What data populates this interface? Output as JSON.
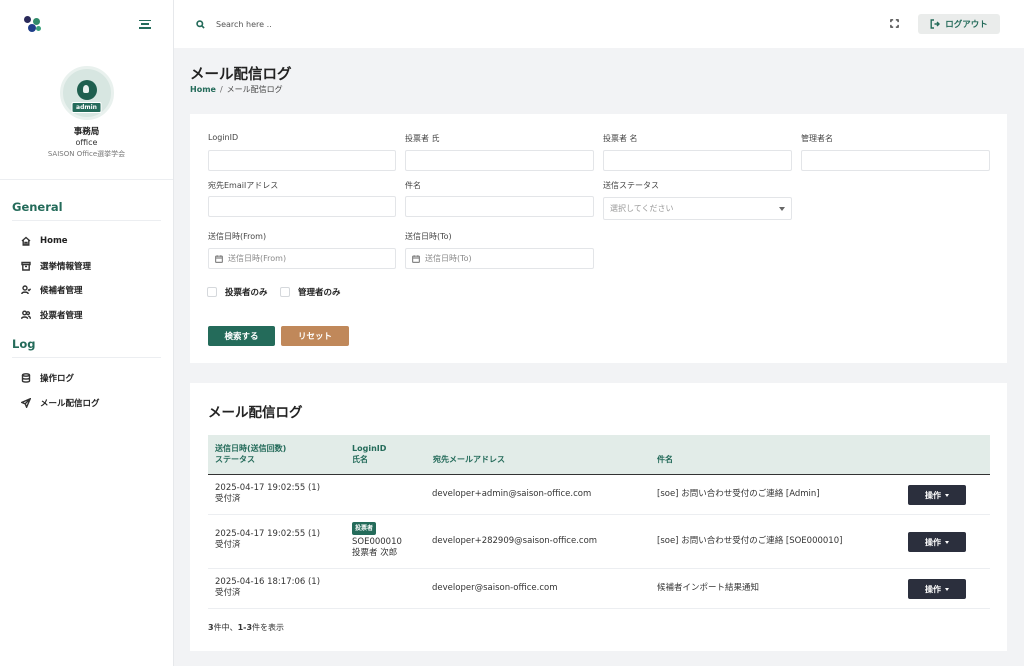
{
  "header": {
    "search_placeholder": "Search here ..",
    "logout_label": "ログアウト"
  },
  "profile": {
    "badge": "admin",
    "name": "事務局",
    "role": "office",
    "org": "SAISON Office選挙学会"
  },
  "sidebar": {
    "general_title": "General",
    "general_items": [
      "Home",
      "選挙情報管理",
      "候補者管理",
      "投票者管理"
    ],
    "log_title": "Log",
    "log_items": [
      "操作ログ",
      "メール配信ログ"
    ]
  },
  "page": {
    "title": "メール配信ログ",
    "breadcrumb_home": "Home",
    "breadcrumb_sep": "/",
    "breadcrumb_current": "メール配信ログ"
  },
  "filters": {
    "login_id": "LoginID",
    "voter_last": "投票者 氏",
    "voter_first": "投票者 名",
    "admin_name": "管理者名",
    "email": "宛先Emailアドレス",
    "subject": "件名",
    "status": "送信ステータス",
    "status_placeholder": "選択してください",
    "date_from": "送信日時(From)",
    "date_from_placeholder": "送信日時(From)",
    "date_to": "送信日時(To)",
    "date_to_placeholder": "送信日時(To)",
    "voters_only": "投票者のみ",
    "admins_only": "管理者のみ",
    "search_button": "検索する",
    "reset_button": "リセット"
  },
  "list": {
    "title": "メール配信ログ",
    "headers": {
      "datetime": "送信日時(送信回数)",
      "status": "ステータス",
      "login_id": "LoginID",
      "name": "氏名",
      "email": "宛先メールアドレス",
      "subject": "件名"
    },
    "rows": [
      {
        "datetime": "2025-04-17 19:02:55 (1)",
        "status": "受付済",
        "badge": "",
        "login_id": "",
        "name": "",
        "email": "developer+admin@saison-office.com",
        "subject": "[soe] お問い合わせ受付のご連絡 [Admin]",
        "action": "操作"
      },
      {
        "datetime": "2025-04-17 19:02:55 (1)",
        "status": "受付済",
        "badge": "投票者",
        "login_id": "SOE000010",
        "name": "投票者 次郎",
        "email": "developer+282909@saison-office.com",
        "subject": "[soe] お問い合わせ受付のご連絡 [SOE000010]",
        "action": "操作"
      },
      {
        "datetime": "2025-04-16 18:17:06 (1)",
        "status": "受付済",
        "badge": "",
        "login_id": "",
        "name": "",
        "email": "developer@saison-office.com",
        "subject": "候補者インポート結果通知",
        "action": "操作"
      }
    ],
    "summary_total": "3",
    "summary_mid": "件中、",
    "summary_range": "1-3",
    "summary_end": "件を表示"
  }
}
